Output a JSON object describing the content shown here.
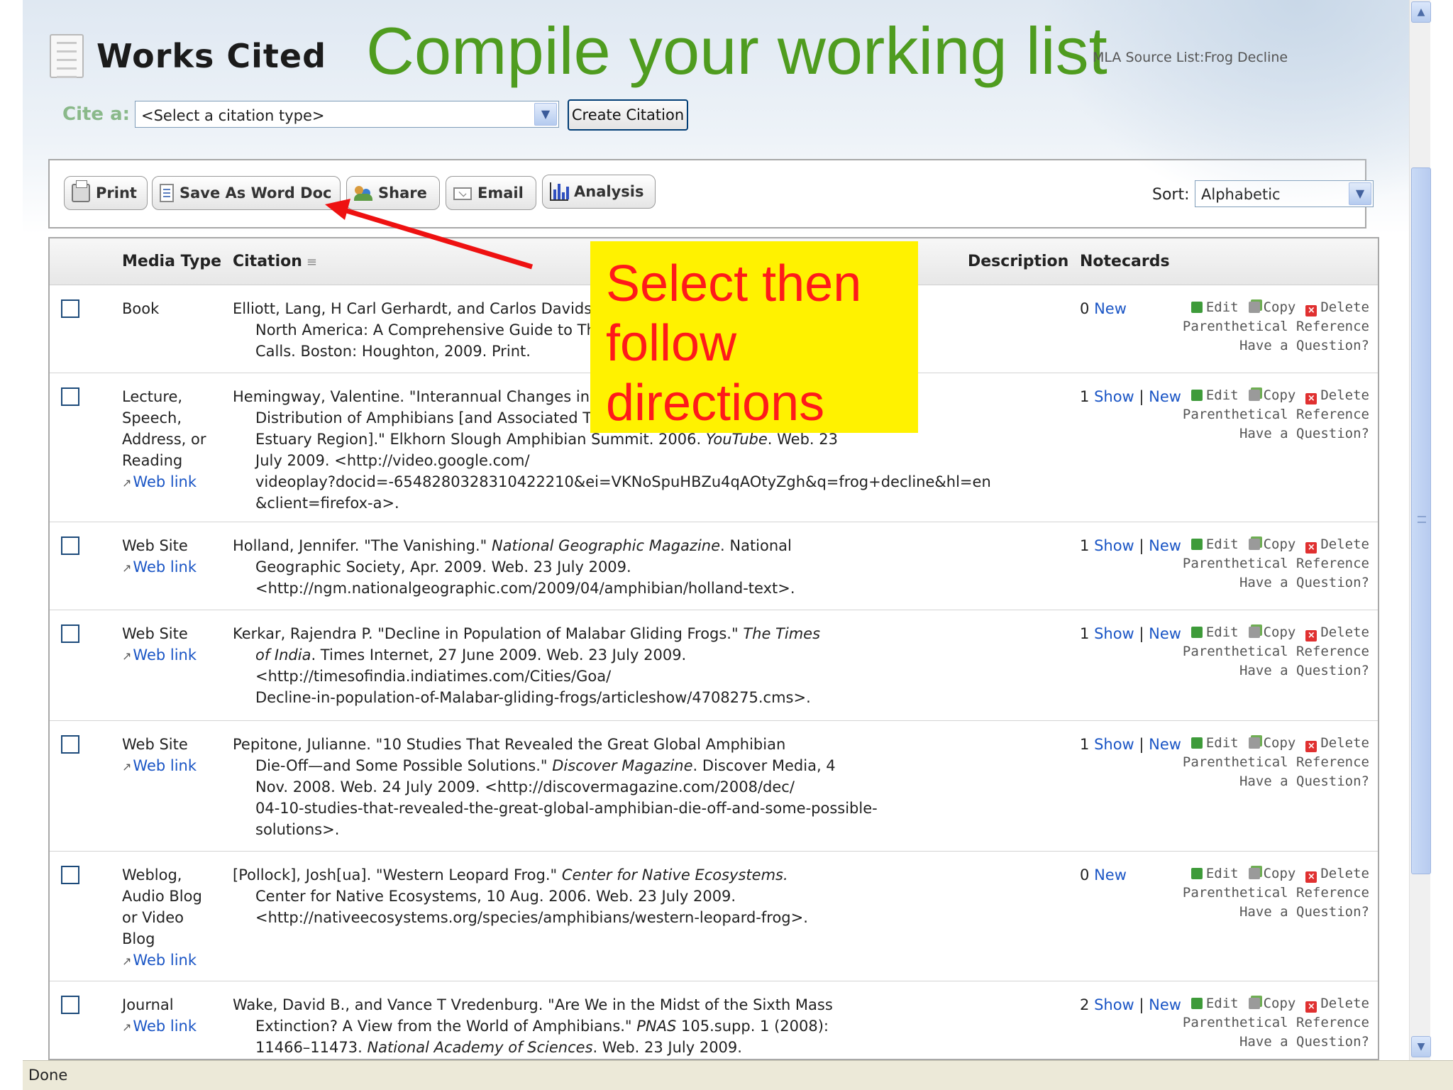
{
  "header": {
    "title": "Works Cited",
    "slide_heading": "Compile your working list",
    "source_list_label": "MLA Source List:",
    "source_list_name": "Frog Decline"
  },
  "cite": {
    "label": "Cite a:",
    "select_value": "<Select a citation type>",
    "create_button": "Create Citation"
  },
  "toolbar": {
    "print": "Print",
    "save_word": "Save As Word Doc",
    "share": "Share",
    "email": "Email",
    "analysis": "Analysis",
    "sort_label": "Sort:",
    "sort_value": "Alphabetic"
  },
  "columns": {
    "media_type": "Media Type",
    "citation": "Citation",
    "description": "Description",
    "notecards": "Notecards"
  },
  "actions": {
    "edit": "Edit",
    "copy": "Copy",
    "delete": "Delete",
    "parenthetical": "Parenthetical Reference",
    "question": "Have a Question?",
    "show": "Show",
    "new": "New",
    "web_link": "Web link"
  },
  "callout": {
    "line1": "Select then",
    "line2": "follow",
    "line3": "directions"
  },
  "rows": [
    {
      "media": [
        "Book"
      ],
      "web_link": false,
      "citation": [
        "Elliott, Lang, H Carl Gerhardt, and Carlos Davidson.",
        "North America: A Comprehensive Guide to Th",
        "Calls. Boston: Houghton, 2009. Print."
      ],
      "count": "0",
      "has_show": false
    },
    {
      "media": [
        "Lecture,",
        "Speech,",
        "Address, or",
        "Reading"
      ],
      "web_link": true,
      "citation": [
        "Hemingway, Valentine. \"Interannual Changes in th",
        "Distribution of Amphibians [and Associated Thr",
        "Estuary Region].\" Elkhorn Slough Amphibian Summit. 2006. YouTube. Web. 23",
        "July 2009. <http://video.google.com/",
        "videoplay?docid=-6548280328310422210&ei=VKNoSpuHBZu4qAOtyZgh&q=frog+decline&hl=en",
        "&client=firefox-a>."
      ],
      "count": "1",
      "has_show": true
    },
    {
      "media": [
        "Web Site"
      ],
      "web_link": true,
      "citation": [
        "Holland, Jennifer. \"The Vanishing.\" National Geographic Magazine. National",
        "Geographic Society, Apr. 2009. Web. 23 July 2009.",
        "<http://ngm.nationalgeographic.com/2009/04/amphibian/holland-text>."
      ],
      "count": "1",
      "has_show": true
    },
    {
      "media": [
        "Web Site"
      ],
      "web_link": true,
      "citation": [
        "Kerkar, Rajendra P. \"Decline in Population of Malabar Gliding Frogs.\" The Times",
        "of India. Times Internet, 27 June 2009. Web. 23 July 2009.",
        "<http://timesofindia.indiatimes.com/Cities/Goa/",
        "Decline-in-population-of-Malabar-gliding-frogs/articleshow/4708275.cms>."
      ],
      "count": "1",
      "has_show": true
    },
    {
      "media": [
        "Web Site"
      ],
      "web_link": true,
      "citation": [
        "Pepitone, Julianne. \"10 Studies That Revealed the Great Global Amphibian",
        "Die-Off—and Some Possible Solutions.\" Discover Magazine. Discover Media, 4",
        "Nov. 2008. Web. 24 July 2009. <http://discovermagazine.com/2008/dec/",
        "04-10-studies-that-revealed-the-great-global-amphibian-die-off-and-some-possible-",
        "solutions>."
      ],
      "count": "1",
      "has_show": true
    },
    {
      "media": [
        "Weblog,",
        "Audio Blog",
        "or Video",
        "Blog"
      ],
      "web_link": true,
      "citation": [
        "[Pollock], Josh[ua]. \"Western Leopard Frog.\" Center for Native Ecosystems.",
        "Center for Native Ecosystems, 10 Aug. 2006. Web. 23 July 2009.",
        "<http://nativeecosystems.org/species/amphibians/western-leopard-frog>."
      ],
      "count": "0",
      "has_show": false
    },
    {
      "media": [
        "Journal"
      ],
      "web_link": true,
      "citation": [
        "Wake, David B., and Vance T Vredenburg. \"Are We in the Midst of the Sixth Mass",
        "Extinction? A View from the World of Amphibians.\" PNAS 105.supp. 1 (2008):",
        "11466–11473. National Academy of Sciences. Web. 23 July 2009."
      ],
      "count": "2",
      "has_show": true
    }
  ],
  "statusbar": {
    "text": "Done"
  }
}
